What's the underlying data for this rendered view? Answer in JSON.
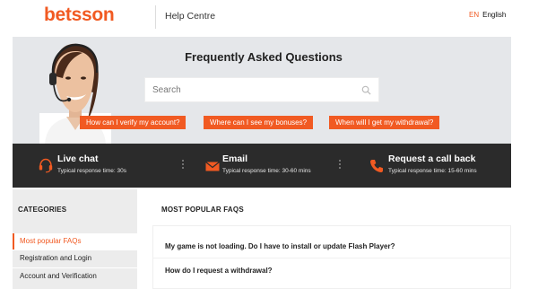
{
  "header": {
    "logo": "betsson",
    "section": "Help Centre",
    "language_code": "EN",
    "language_name": "English"
  },
  "hero": {
    "title": "Frequently Asked Questions",
    "search_placeholder": "Search",
    "quick_questions": [
      "How can I verify my account?",
      "Where can I see my bonuses?",
      "When will I get my withdrawal?"
    ]
  },
  "contact": {
    "items": [
      {
        "title": "Live chat",
        "subtitle": "Typical response time: 30s",
        "icon": "headset-icon"
      },
      {
        "title": "Email",
        "subtitle": "Typical response time: 30-60 mins",
        "icon": "envelope-icon"
      },
      {
        "title": "Request a call back",
        "subtitle": "Typical response time: 15-60 mins",
        "icon": "phone-icon"
      }
    ]
  },
  "sidebar": {
    "title": "CATEGORIES",
    "items": [
      {
        "label": "Most popular FAQs",
        "active": true
      },
      {
        "label": "Registration and Login",
        "active": false
      },
      {
        "label": "Account and Verification",
        "active": false
      }
    ]
  },
  "main": {
    "title": "MOST POPULAR FAQS",
    "faqs": [
      "My game is not loading. Do I have to install or update Flash Player?",
      "How do I request a withdrawal?"
    ]
  },
  "colors": {
    "accent": "#f15a22",
    "contact_bar": "#2b2b2b",
    "hero_bg": "#e5e7ea",
    "sidebar_bg": "#ececec"
  }
}
